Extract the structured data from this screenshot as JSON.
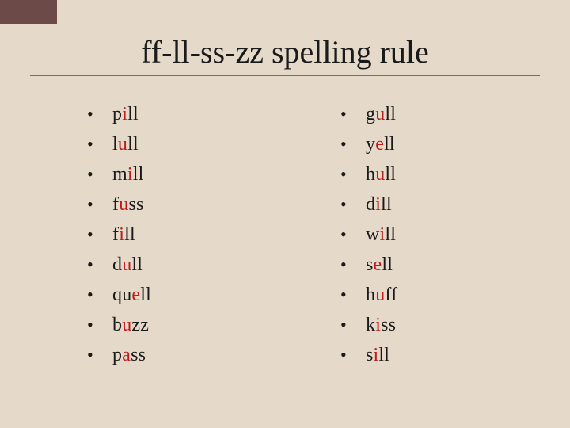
{
  "title": "ff-ll-ss-zz spelling rule",
  "bullet": "•",
  "colors": {
    "vowel": "#c11a1a",
    "background": "#e5d9c9",
    "corner": "#6b4a47"
  },
  "columns": [
    {
      "words": [
        {
          "pre": "p",
          "vowel": "i",
          "post": "ll"
        },
        {
          "pre": "l",
          "vowel": "u",
          "post": "ll"
        },
        {
          "pre": "m",
          "vowel": "i",
          "post": "ll"
        },
        {
          "pre": "f",
          "vowel": "u",
          "post": "ss"
        },
        {
          "pre": "f",
          "vowel": "i",
          "post": "ll"
        },
        {
          "pre": "d",
          "vowel": "u",
          "post": "ll"
        },
        {
          "pre": "qu",
          "vowel": "e",
          "post": "ll"
        },
        {
          "pre": "b",
          "vowel": "u",
          "post": "zz"
        },
        {
          "pre": "p",
          "vowel": "a",
          "post": "ss"
        }
      ]
    },
    {
      "words": [
        {
          "pre": "g",
          "vowel": "u",
          "post": "ll"
        },
        {
          "pre": "y",
          "vowel": "e",
          "post": "ll"
        },
        {
          "pre": "h",
          "vowel": "u",
          "post": "ll"
        },
        {
          "pre": "d",
          "vowel": "i",
          "post": "ll"
        },
        {
          "pre": "w",
          "vowel": "i",
          "post": "ll"
        },
        {
          "pre": "s",
          "vowel": "e",
          "post": "ll"
        },
        {
          "pre": "h",
          "vowel": "u",
          "post": "ff"
        },
        {
          "pre": "k",
          "vowel": "i",
          "post": "ss"
        },
        {
          "pre": "s",
          "vowel": "i",
          "post": "ll"
        }
      ]
    }
  ]
}
